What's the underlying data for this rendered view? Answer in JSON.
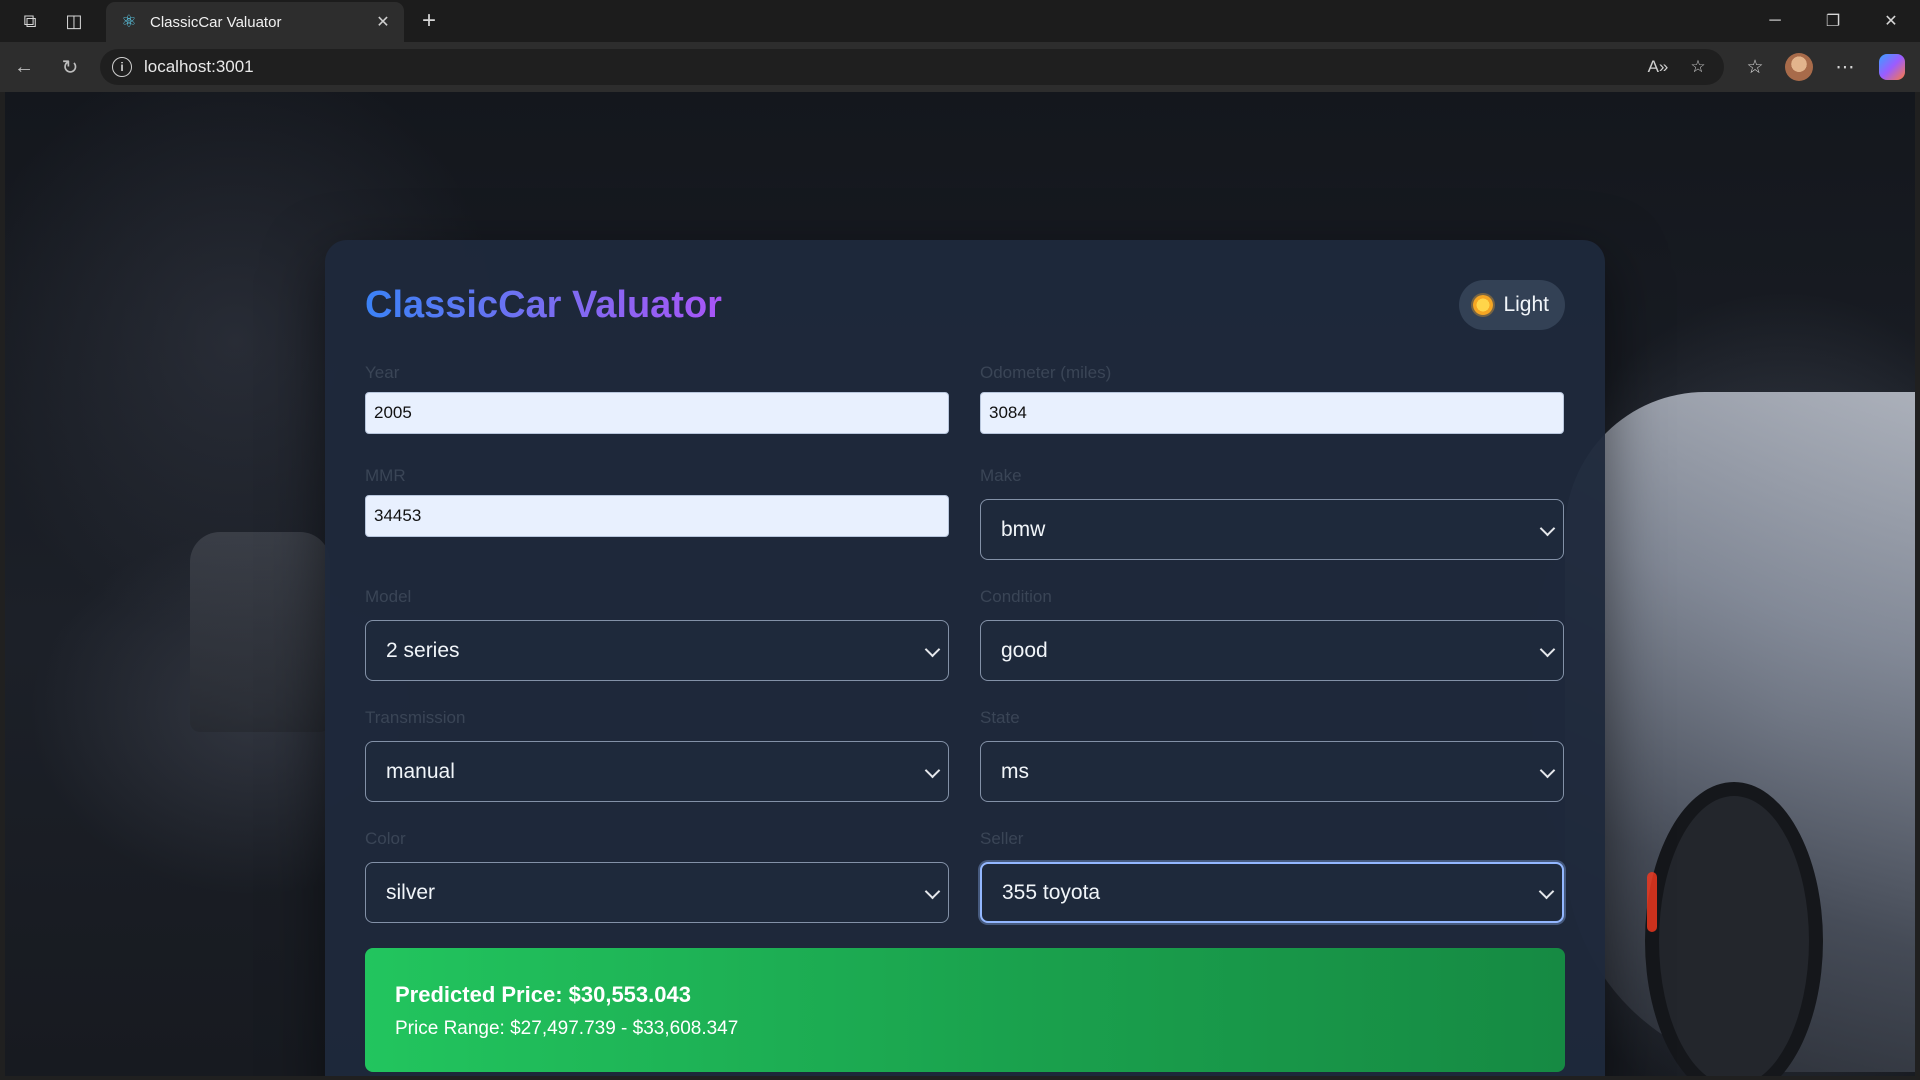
{
  "browser": {
    "tab_title": "ClassicCar Valuator",
    "url": "localhost:3001"
  },
  "app": {
    "title": "ClassicCar Valuator",
    "theme_toggle_label": "Light"
  },
  "form": {
    "year": {
      "label": "Year",
      "value": "2005"
    },
    "odometer": {
      "label": "Odometer (miles)",
      "value": "3084"
    },
    "mmr": {
      "label": "MMR",
      "value": "34453"
    },
    "make": {
      "label": "Make",
      "value": "bmw"
    },
    "model": {
      "label": "Model",
      "value": "2 series"
    },
    "condition": {
      "label": "Condition",
      "value": "good"
    },
    "transmission": {
      "label": "Transmission",
      "value": "manual"
    },
    "state": {
      "label": "State",
      "value": "ms"
    },
    "color": {
      "label": "Color",
      "value": "silver"
    },
    "seller": {
      "label": "Seller",
      "value": "355 toyota"
    }
  },
  "result": {
    "predicted_price": "Predicted Price: $30,553.043",
    "price_range": "Price Range: $27,497.739 - $33,608.347"
  },
  "colors": {
    "card_bg": "#1e293b",
    "title_gradient_start": "#3b82f6",
    "title_gradient_end": "#a855f7",
    "result_green": "#22c55e"
  }
}
